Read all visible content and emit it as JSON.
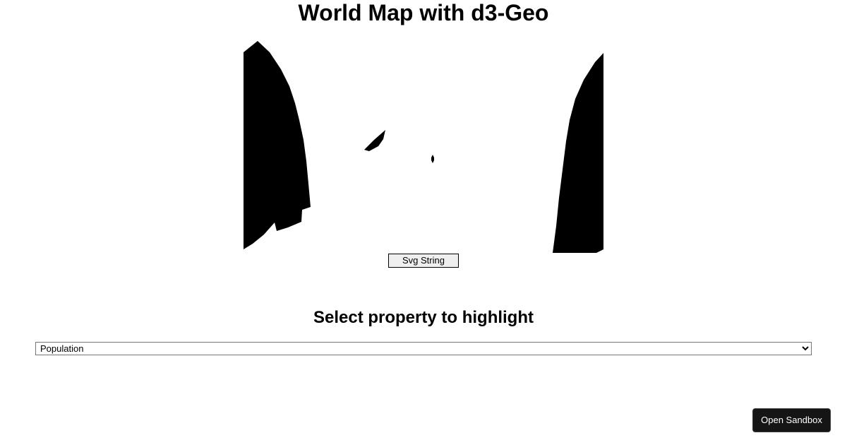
{
  "page": {
    "title": "World Map with d3-Geo",
    "subtitle": "Select property to highlight"
  },
  "map": {
    "fill_color": "#000000",
    "background_color": "#ffffff"
  },
  "controls": {
    "svg_button_label": "Svg String",
    "property_select": {
      "selected": "Population",
      "options": [
        "Population"
      ]
    }
  },
  "sandbox": {
    "label": "Open Sandbox",
    "background_color": "#151515",
    "text_color": "#ffffff"
  }
}
